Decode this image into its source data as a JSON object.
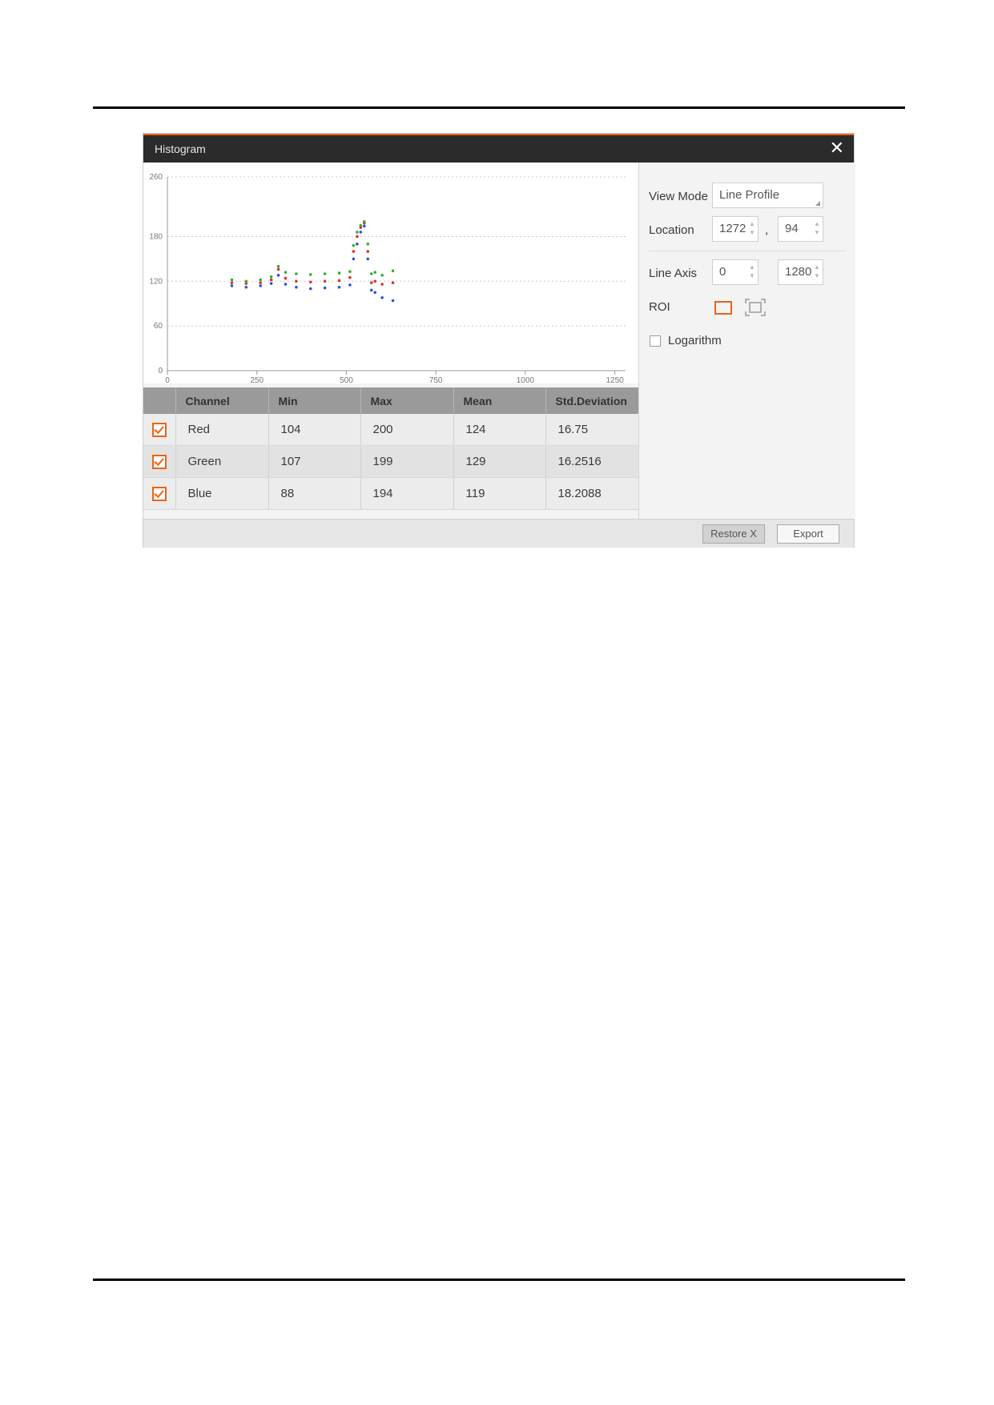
{
  "window": {
    "title": "Histogram",
    "close_icon": "close-icon"
  },
  "chart_data": {
    "type": "scatter",
    "title": "",
    "xlabel": "",
    "ylabel": "",
    "xlim": [
      0,
      1280
    ],
    "ylim": [
      0,
      260
    ],
    "x_ticks": [
      "0",
      "250",
      "500",
      "750",
      "1000",
      "1250"
    ],
    "y_ticks": [
      "0",
      "60",
      "120",
      "180",
      "260"
    ],
    "grid": "horizontal-dotted",
    "series": [
      {
        "color": "#e03030",
        "x": [
          180,
          220,
          260,
          290,
          310,
          330,
          360,
          400,
          440,
          480,
          510,
          520,
          530,
          540,
          550,
          560,
          570,
          580,
          600,
          630
        ],
        "y": [
          118,
          117,
          118,
          122,
          136,
          124,
          120,
          119,
          120,
          121,
          125,
          160,
          180,
          192,
          198,
          160,
          118,
          120,
          116,
          118
        ]
      },
      {
        "color": "#30b030",
        "x": [
          180,
          220,
          260,
          290,
          310,
          330,
          360,
          400,
          440,
          480,
          510,
          520,
          530,
          540,
          550,
          560,
          570,
          580,
          600,
          630
        ],
        "y": [
          122,
          120,
          122,
          126,
          140,
          132,
          130,
          129,
          130,
          131,
          133,
          168,
          186,
          195,
          200,
          170,
          130,
          132,
          128,
          134
        ]
      },
      {
        "color": "#3050e0",
        "x": [
          180,
          220,
          260,
          290,
          310,
          330,
          360,
          400,
          440,
          480,
          510,
          520,
          530,
          540,
          550,
          560,
          570,
          580,
          600,
          630
        ],
        "y": [
          114,
          112,
          114,
          117,
          128,
          116,
          112,
          110,
          111,
          112,
          115,
          150,
          170,
          186,
          194,
          150,
          108,
          105,
          98,
          94
        ]
      }
    ]
  },
  "table": {
    "headers": [
      "Channel",
      "Min",
      "Max",
      "Mean",
      "Std.Deviation"
    ],
    "rows": [
      {
        "channel": "Red",
        "min": "104",
        "max": "200",
        "mean": "124",
        "std": "16.75",
        "checked": true
      },
      {
        "channel": "Green",
        "min": "107",
        "max": "199",
        "mean": "129",
        "std": "16.2516",
        "checked": true
      },
      {
        "channel": "Blue",
        "min": "88",
        "max": "194",
        "mean": "119",
        "std": "18.2088",
        "checked": true
      }
    ]
  },
  "panel": {
    "view_mode_label": "View Mode",
    "view_mode_value": "Line Profile",
    "location_label": "Location",
    "location_x": "1272",
    "location_sep": ",",
    "location_y": "94",
    "line_axis_label": "Line Axis",
    "line_axis_start": "0",
    "line_axis_end": "1280",
    "roi_label": "ROI",
    "logarithm_label": "Logarithm",
    "logarithm_checked": false
  },
  "buttons": {
    "restore": "Restore X",
    "export": "Export"
  },
  "colors": {
    "accent": "#e8641b",
    "titlebar": "#2b2b2b"
  }
}
